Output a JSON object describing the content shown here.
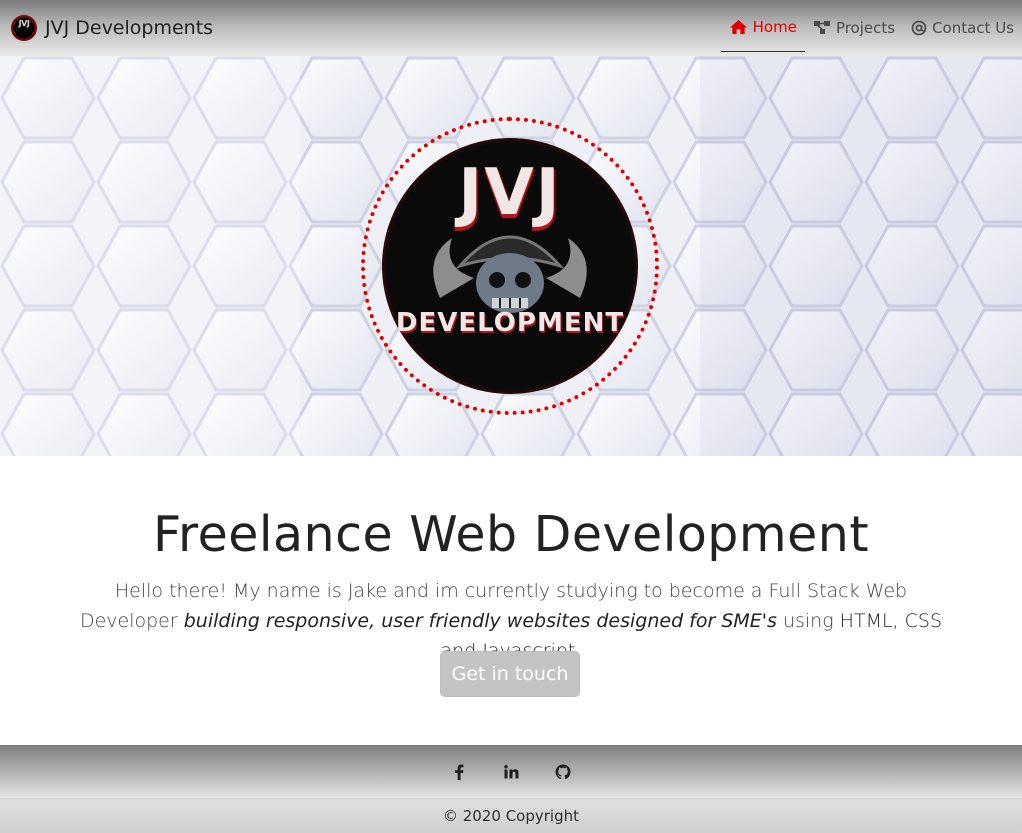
{
  "navbar": {
    "brand": "JVJ Developments",
    "items": [
      {
        "label": "Home",
        "icon": "home-icon",
        "active": true
      },
      {
        "label": "Projects",
        "icon": "projects-icon",
        "active": false
      },
      {
        "label": "Contact Us",
        "icon": "at-icon",
        "active": false
      }
    ]
  },
  "hero": {
    "logo_top_text": "JVJ",
    "logo_bottom_text": "DEVELOPMENT"
  },
  "main": {
    "title": "Freelance Web Development",
    "lead_plain_1": "Hello there! My name is Jake and im currently studying to become a Full Stack Web Developer ",
    "lead_emphasis": "building responsive, user friendly websites designed for SME's",
    "lead_plain_2": " using ",
    "lead_tech": "HTML, CSS and Javascript",
    "lead_end": ".",
    "cta_label": "Get in touch"
  },
  "footer": {
    "social_icons": [
      "facebook-icon",
      "linkedin-icon",
      "github-icon"
    ],
    "copyright": "© 2020 Copyright"
  },
  "colors": {
    "accent_red": "#e00000",
    "cta_bg": "#c4c4c4"
  }
}
